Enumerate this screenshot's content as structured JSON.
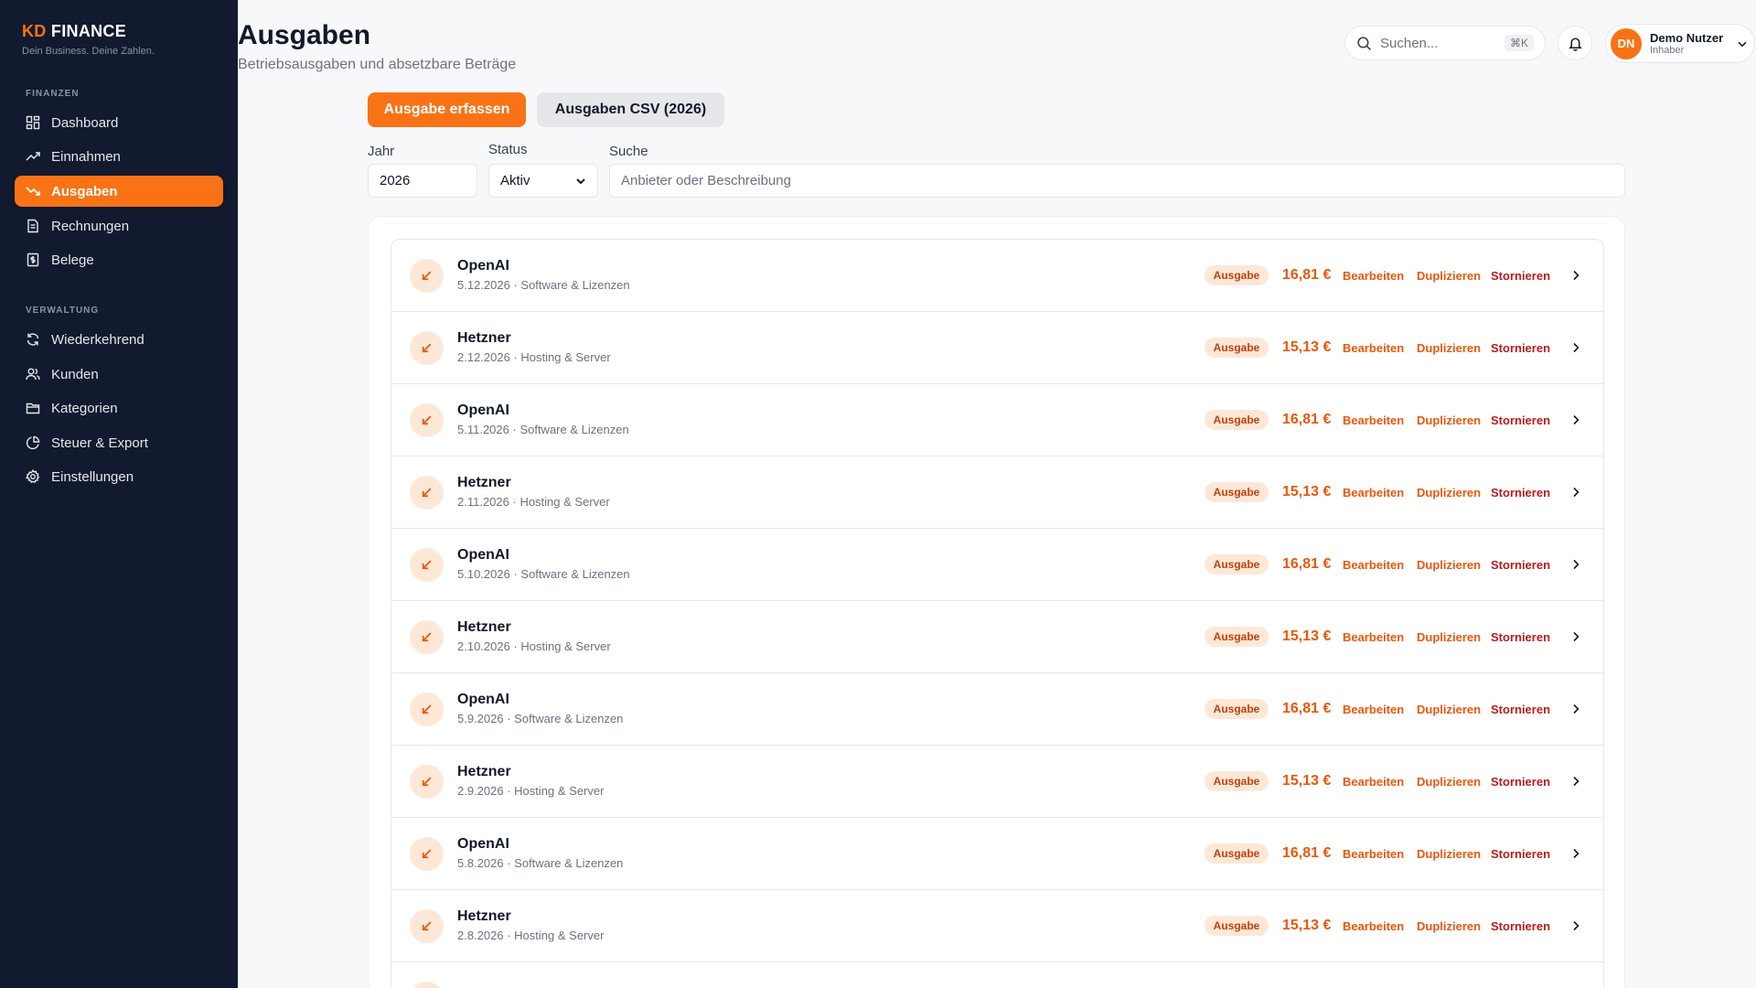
{
  "brand": {
    "kd": "KD",
    "name": "FINANCE",
    "tagline": "Dein Business. Deine Zahlen."
  },
  "sidebar": {
    "section1": "FINANZEN",
    "section2": "VERWALTUNG",
    "items": [
      {
        "label": "Dashboard",
        "icon": "dashboard-icon"
      },
      {
        "label": "Einnahmen",
        "icon": "trending-up-icon"
      },
      {
        "label": "Ausgaben",
        "icon": "trending-down-icon",
        "active": true
      },
      {
        "label": "Rechnungen",
        "icon": "invoice-icon"
      },
      {
        "label": "Belege",
        "icon": "receipt-icon"
      },
      {
        "label": "Wiederkehrend",
        "icon": "refresh-icon"
      },
      {
        "label": "Kunden",
        "icon": "users-icon"
      },
      {
        "label": "Kategorien",
        "icon": "folder-icon"
      },
      {
        "label": "Steuer & Export",
        "icon": "pie-chart-icon"
      },
      {
        "label": "Einstellungen",
        "icon": "gear-icon"
      }
    ]
  },
  "header": {
    "title": "Ausgaben",
    "subtitle": "Betriebsausgaben und absetzbare Beträge",
    "search_placeholder": "Suchen...",
    "search_shortcut": "⌘K",
    "user": {
      "initials": "DN",
      "name": "Demo Nutzer",
      "role": "Inhaber"
    }
  },
  "toolbar": {
    "primary_label": "Ausgabe erfassen",
    "secondary_label": "Ausgaben CSV (2026)"
  },
  "filters": {
    "year_label": "Jahr",
    "year_value": "2026",
    "status_label": "Status",
    "status_value": "Aktiv",
    "search_label": "Suche",
    "search_placeholder": "Anbieter oder Beschreibung"
  },
  "actions": {
    "edit": "Bearbeiten",
    "duplicate": "Duplizieren",
    "cancel": "Stornieren"
  },
  "rows": [
    {
      "title": "OpenAI",
      "date": "5.12.2026",
      "category": "Software & Lizenzen",
      "badge": "Ausgabe",
      "amount": "16,81 €"
    },
    {
      "title": "Hetzner",
      "date": "2.12.2026",
      "category": "Hosting & Server",
      "badge": "Ausgabe",
      "amount": "15,13 €"
    },
    {
      "title": "OpenAI",
      "date": "5.11.2026",
      "category": "Software & Lizenzen",
      "badge": "Ausgabe",
      "amount": "16,81 €"
    },
    {
      "title": "Hetzner",
      "date": "2.11.2026",
      "category": "Hosting & Server",
      "badge": "Ausgabe",
      "amount": "15,13 €"
    },
    {
      "title": "OpenAI",
      "date": "5.10.2026",
      "category": "Software & Lizenzen",
      "badge": "Ausgabe",
      "amount": "16,81 €"
    },
    {
      "title": "Hetzner",
      "date": "2.10.2026",
      "category": "Hosting & Server",
      "badge": "Ausgabe",
      "amount": "15,13 €"
    },
    {
      "title": "OpenAI",
      "date": "5.9.2026",
      "category": "Software & Lizenzen",
      "badge": "Ausgabe",
      "amount": "16,81 €"
    },
    {
      "title": "Hetzner",
      "date": "2.9.2026",
      "category": "Hosting & Server",
      "badge": "Ausgabe",
      "amount": "15,13 €"
    },
    {
      "title": "OpenAI",
      "date": "5.8.2026",
      "category": "Software & Lizenzen",
      "badge": "Ausgabe",
      "amount": "16,81 €"
    },
    {
      "title": "Hetzner",
      "date": "2.8.2026",
      "category": "Hosting & Server",
      "badge": "Ausgabe",
      "amount": "15,13 €"
    },
    {
      "title": "",
      "date": "",
      "category": "",
      "badge": "",
      "amount": ""
    }
  ],
  "colors": {
    "accent": "#f97316",
    "sidebar_bg": "#111a2e",
    "danger": "#b91c1c"
  }
}
